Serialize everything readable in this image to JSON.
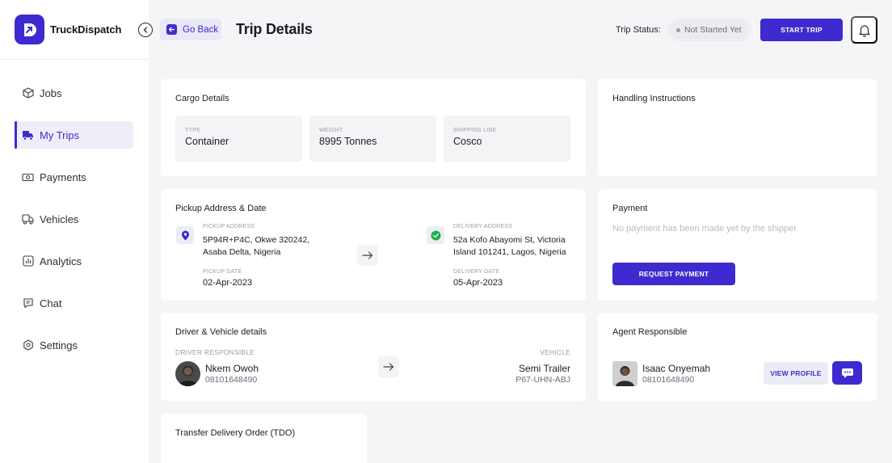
{
  "brand": {
    "name": "TruckDispatch",
    "accent": "#3d2bd0"
  },
  "sidebar": {
    "items": [
      {
        "label": "Jobs",
        "icon": "box-icon",
        "active": false
      },
      {
        "label": "My Trips",
        "icon": "truck-icon",
        "active": true
      },
      {
        "label": "Payments",
        "icon": "money-icon",
        "active": false
      },
      {
        "label": "Vehicles",
        "icon": "vehicle-icon",
        "active": false
      },
      {
        "label": "Analytics",
        "icon": "chart-icon",
        "active": false
      },
      {
        "label": "Chat",
        "icon": "chat-icon",
        "active": false
      },
      {
        "label": "Settings",
        "icon": "gear-icon",
        "active": false
      }
    ]
  },
  "header": {
    "back_label": "Go Back",
    "title": "Trip Details",
    "status_label": "Trip Status:",
    "status_value": "Not Started Yet",
    "start_label": "START TRIP"
  },
  "cargo": {
    "title": "Cargo Details",
    "type_label": "TYPE",
    "type_value": "Container",
    "weight_label": "WEIGHT",
    "weight_value": "8995 Tonnes",
    "line_label": "SHIPPING LINE",
    "line_value": "Cosco"
  },
  "handling": {
    "title": "Handling Instructions"
  },
  "pickup": {
    "title": "Pickup Address & Date",
    "pickup_address_label": "PICKUP ADDRESS",
    "pickup_address_line1": "5P94R+P4C, Okwe 320242,",
    "pickup_address_line2": "Asaba Delta, Nigeria",
    "pickup_date_label": "PICKUP DATE",
    "pickup_date": "02-Apr-2023",
    "delivery_address_label": "DELIVERY ADDRESS",
    "delivery_address_line1": "52a Kofo Abayomi St, Victoria",
    "delivery_address_line2": "Island 101241, Lagos, Nigeria",
    "delivery_date_label": "DELIVERY DATE",
    "delivery_date": "05-Apr-2023"
  },
  "payment": {
    "title": "Payment",
    "note": "No payment has been made yet by the shipper",
    "request_label": "REQUEST PAYMENT"
  },
  "driver": {
    "title": "Driver & Vehicle details",
    "driver_label": "DRIVER RESPONSIBLE",
    "driver_name": "Nkem Owoh",
    "driver_phone": "08101648490",
    "vehicle_label": "VEHICLE",
    "vehicle_type": "Semi Trailer",
    "vehicle_plate": "P67-UHN-ABJ"
  },
  "agent": {
    "title": "Agent Responsible",
    "name": "Isaac Onyemah",
    "phone": "08101648490",
    "view_label": "VIEW PROFILE"
  },
  "tdo": {
    "title": "Transfer Delivery Order (TDO)"
  }
}
